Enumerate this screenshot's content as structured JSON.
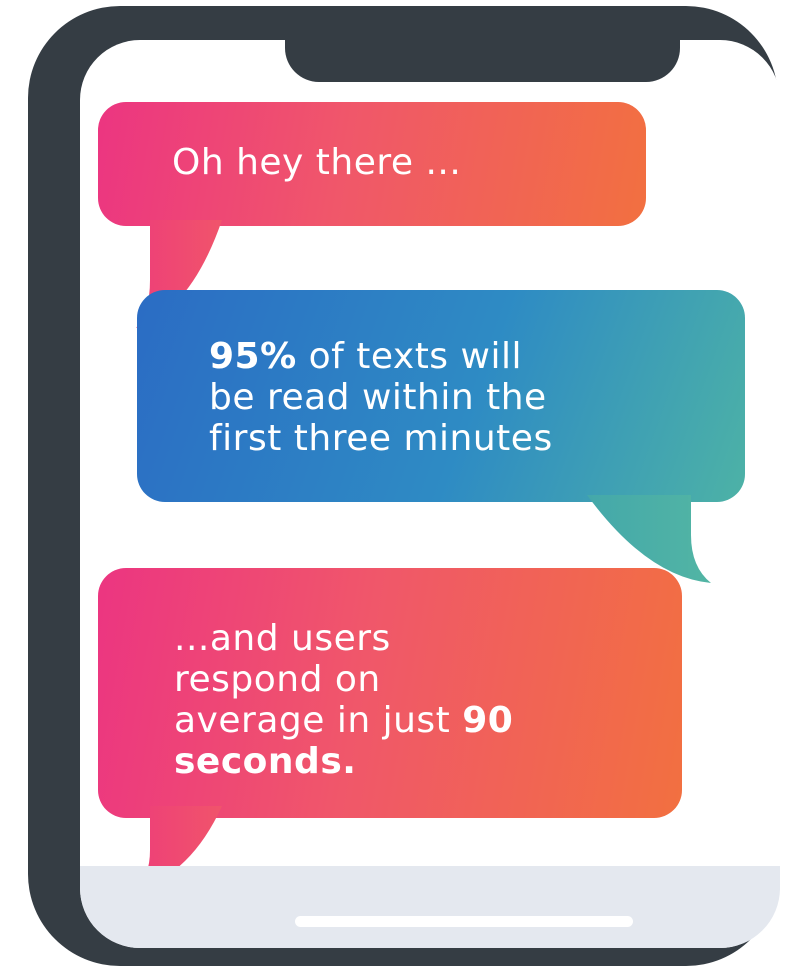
{
  "messages": [
    {
      "id": "greeting",
      "text": "Oh hey there ..."
    },
    {
      "id": "read-stat",
      "highlight": "95%",
      "line1_rest": " of texts will",
      "line2": "be read within the",
      "line3": "first three minutes"
    },
    {
      "id": "response-stat",
      "line1": "...and users",
      "line2": "respond on",
      "line3_prefix": "average in just ",
      "line3_highlight": "90",
      "line4_highlight": "seconds."
    }
  ],
  "colors": {
    "phone_frame": "#353d44",
    "warm_gradient": [
      "#ec3581",
      "#f0576a",
      "#f27040"
    ],
    "cool_gradient": [
      "#2b6cc4",
      "#2e8bc4",
      "#4db2a6"
    ],
    "home_area": "#e4e8ef"
  }
}
